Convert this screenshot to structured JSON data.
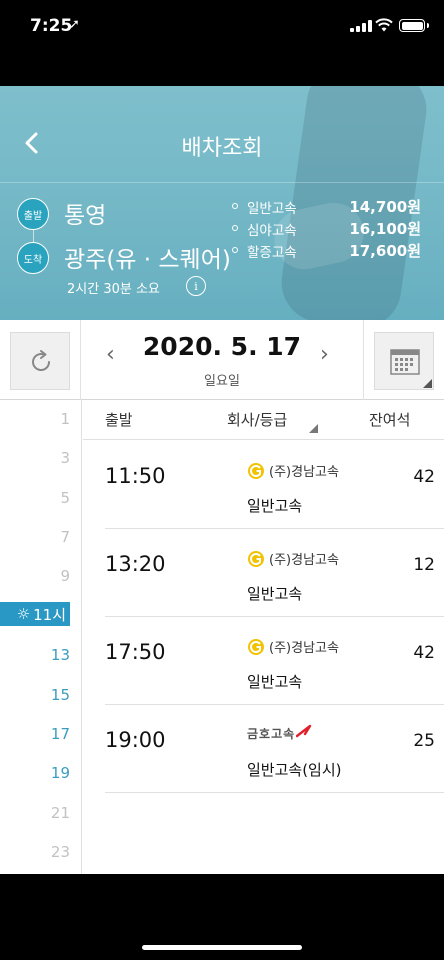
{
  "status_bar": {
    "time": "7:25",
    "location_icon": "location-arrow-icon"
  },
  "header": {
    "title": "배차조회",
    "back_icon": "chevron-left-icon",
    "departure_badge": "출발",
    "departure_city": "통영",
    "arrival_badge": "도착",
    "arrival_city": "광주(유 · 스퀘어)",
    "duration": "2시간 30분 소요",
    "info_icon_glyph": "i",
    "fares": [
      {
        "name": "일반고속",
        "price": "14,700원"
      },
      {
        "name": "심야고속",
        "price": "16,100원"
      },
      {
        "name": "할증고속",
        "price": "17,600원"
      }
    ]
  },
  "date_bar": {
    "prev": "‹",
    "date": "2020. 5. 17",
    "weekday": "일요일",
    "next": "›",
    "refresh_icon": "refresh-icon",
    "calendar_icon": "calendar-icon"
  },
  "hour_column": {
    "hours": [
      "1",
      "3",
      "5",
      "7",
      "9"
    ],
    "current": {
      "icon": "sun-icon",
      "label": "11시"
    },
    "active_hours": [
      "13",
      "15",
      "17",
      "19"
    ],
    "later_hours": [
      "21",
      "23"
    ]
  },
  "list": {
    "headers": {
      "time": "출발",
      "company": "회사/등급",
      "seats": "잔여석"
    },
    "rows": [
      {
        "time": "11:50",
        "company": "(주)경남고속",
        "logo": "gyeongnam-logo",
        "grade": "일반고속",
        "seats": "42"
      },
      {
        "time": "13:20",
        "company": "(주)경남고속",
        "logo": "gyeongnam-logo",
        "grade": "일반고속",
        "seats": "12"
      },
      {
        "time": "17:50",
        "company": "(주)경남고속",
        "logo": "gyeongnam-logo",
        "grade": "일반고속",
        "seats": "42"
      },
      {
        "time": "19:00",
        "company": "금호고속",
        "logo": "kumho-logo",
        "grade": "일반고속(임시)",
        "seats": "25"
      }
    ]
  },
  "colors": {
    "header_bg": "#73b7c6",
    "accent_blue": "#2a98c4",
    "active_hour": "#3a9dbd",
    "gyeongnam_logo": "#f2c200",
    "kumho_red": "#e0202a"
  }
}
